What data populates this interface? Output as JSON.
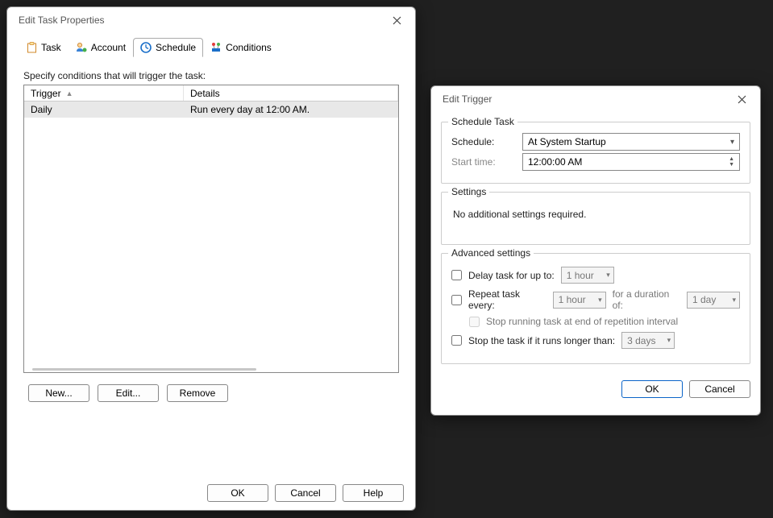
{
  "main": {
    "title": "Edit Task Properties",
    "tabs": [
      {
        "label": "Task"
      },
      {
        "label": "Account"
      },
      {
        "label": "Schedule"
      },
      {
        "label": "Conditions"
      }
    ],
    "instruction": "Specify conditions that will trigger the task:",
    "columns": {
      "trigger": "Trigger",
      "details": "Details"
    },
    "rows": [
      {
        "trigger": "Daily",
        "details": "Run every day at 12:00 AM."
      }
    ],
    "buttons": {
      "new": "New...",
      "edit": "Edit...",
      "remove": "Remove"
    },
    "footer": {
      "ok": "OK",
      "cancel": "Cancel",
      "help": "Help"
    }
  },
  "trigger": {
    "title": "Edit Trigger",
    "schedule_task": {
      "legend": "Schedule Task",
      "schedule_label": "Schedule:",
      "schedule_value": "At System Startup",
      "start_label": "Start time:",
      "start_value": "12:00:00 AM"
    },
    "settings": {
      "legend": "Settings",
      "text": "No additional settings required."
    },
    "advanced": {
      "legend": "Advanced settings",
      "delay_label": "Delay task for up to:",
      "delay_value": "1 hour",
      "repeat_label": "Repeat task every:",
      "repeat_value": "1 hour",
      "duration_label": "for a duration of:",
      "duration_value": "1 day",
      "stop_end_label": "Stop running task at end of repetition interval",
      "stop_long_label": "Stop the task if it runs longer than:",
      "stop_long_value": "3 days"
    },
    "footer": {
      "ok": "OK",
      "cancel": "Cancel"
    }
  }
}
